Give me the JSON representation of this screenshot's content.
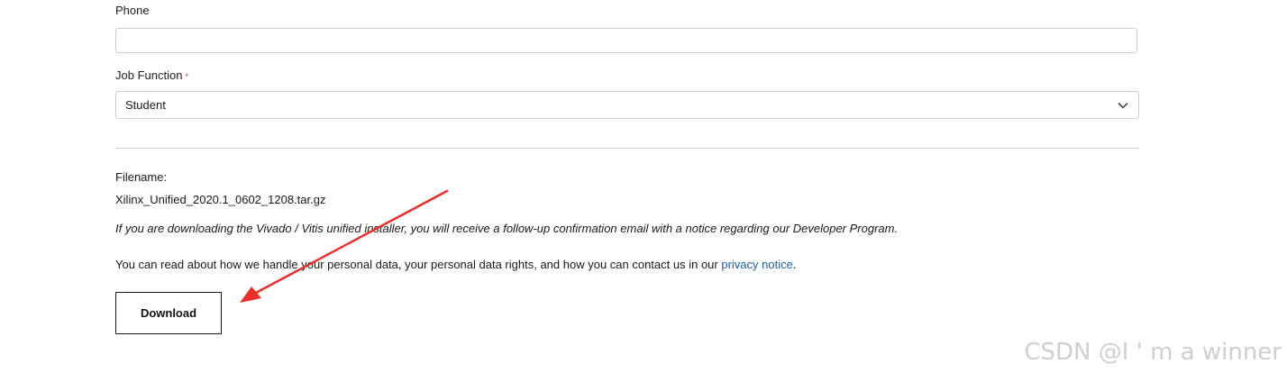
{
  "phone": {
    "label": "Phone",
    "value": "",
    "placeholder": ""
  },
  "job_function": {
    "label": "Job Function",
    "required_marker": "*",
    "selected": "Student"
  },
  "file": {
    "filename_label": "Filename:",
    "filename": "Xilinx_Unified_2020.1_0602_1208.tar.gz",
    "notice": "If you are downloading the Vivado / Vitis unified installer, you will receive a follow-up confirmation email with a notice regarding our Developer Program.",
    "privacy_text": "You can read about how we handle your personal data, your personal data rights, and how you can contact us in our ",
    "privacy_link": "privacy notice",
    "privacy_end": "."
  },
  "download_label": "Download",
  "watermark": "CSDN @I ' m a winner",
  "colors": {
    "arrow": "#e8312a",
    "link": "#1f5fa8"
  }
}
